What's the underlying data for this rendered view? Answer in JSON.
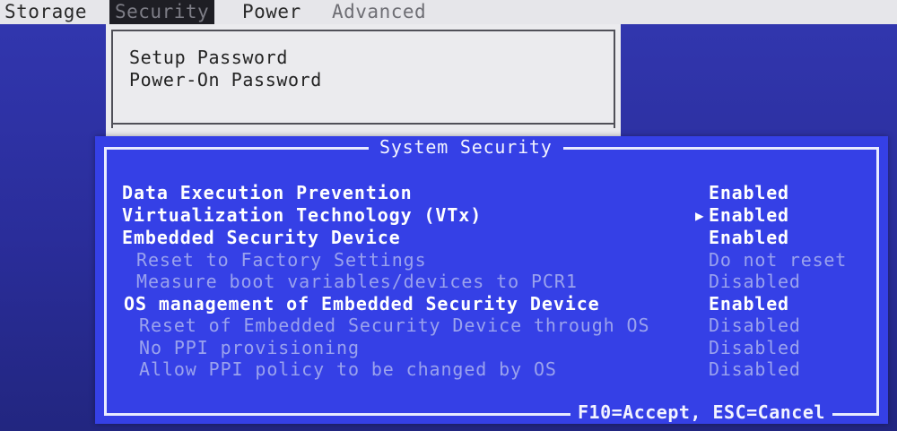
{
  "menu": {
    "items": [
      {
        "label": "Storage",
        "state": "normal"
      },
      {
        "label": "Security",
        "state": "active"
      },
      {
        "label": "Power",
        "state": "normal"
      },
      {
        "label": "Advanced",
        "state": "dim"
      }
    ]
  },
  "dropdown": {
    "items": [
      "Setup Password",
      "Power-On Password"
    ]
  },
  "dialog": {
    "title": "System Security",
    "footer": "F10=Accept, ESC=Cancel",
    "selected_row": 1,
    "rows": [
      {
        "label": "Data Execution Prevention",
        "value": "Enabled",
        "enabled": true
      },
      {
        "label": "Virtualization Technology (VTx)",
        "value": "Enabled",
        "enabled": true
      },
      {
        "label": "Embedded Security Device",
        "value": "Enabled",
        "enabled": true
      },
      {
        "label": "Reset to Factory Settings",
        "value": "Do not reset",
        "enabled": false
      },
      {
        "label": "Measure boot variables/devices to PCR1",
        "value": "Disabled",
        "enabled": false
      },
      {
        "label": "OS management of Embedded Security Device",
        "value": "Enabled",
        "enabled": true
      },
      {
        "label": "Reset of Embedded Security Device through OS",
        "value": "Disabled",
        "enabled": false
      },
      {
        "label": "No PPI provisioning",
        "value": "Disabled",
        "enabled": false
      },
      {
        "label": "Allow PPI policy to be changed by OS",
        "value": "Disabled",
        "enabled": false
      }
    ]
  },
  "colors": {
    "dialog_bg": "#3540e6",
    "menubar_bg": "#e6e6ea",
    "active_tab_bg": "#1e1e24",
    "enabled_text": "#ffffff",
    "disabled_text": "#9aa2ee"
  }
}
